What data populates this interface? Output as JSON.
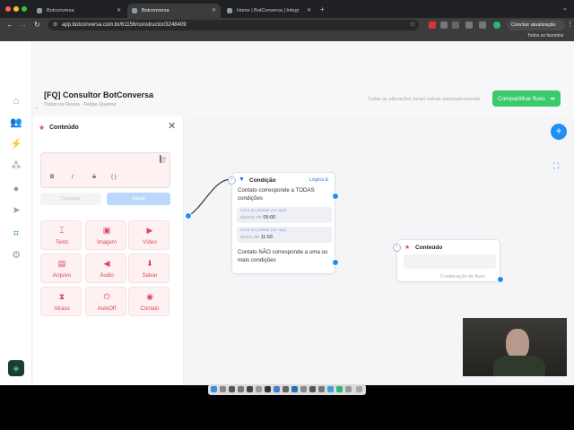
{
  "browser": {
    "tabs": [
      {
        "title": "Botconversa",
        "active": false
      },
      {
        "title": "Botconversa",
        "active": true
      },
      {
        "title": "Home | BotConversa | Integr",
        "active": false
      }
    ],
    "url": "app.botconversa.com.br/61156/constructor/3248409",
    "update_button": "Concluir atualização",
    "bookmarks_label": "Todos os favoritos"
  },
  "sidebar": {
    "items": [
      "home-icon",
      "users-icon",
      "bolt-icon",
      "share-icon",
      "chat-icon",
      "send-icon",
      "flow-icon",
      "gear-icon"
    ],
    "active_index": 6
  },
  "header": {
    "title": "[FQ] Consultor BotConversa",
    "breadcrumb": "Todos os Fluxos · Felipe Queiroz",
    "saved_status": "Todas as alterações foram salvas automaticamente",
    "share_button": "Compartilhar fluxo"
  },
  "panel": {
    "title": "Conteúdo",
    "format_buttons": [
      "B",
      "I",
      "S",
      "{ }"
    ],
    "cancel_label": "Cancelar",
    "save_label": "Salvar",
    "content_types": [
      {
        "label": "Texto",
        "icon": "text-icon",
        "glyph": "⌶"
      },
      {
        "label": "Imagem",
        "icon": "image-icon",
        "glyph": "▣"
      },
      {
        "label": "Vídeo",
        "icon": "video-icon",
        "glyph": "▶"
      },
      {
        "label": "Arquivo",
        "icon": "file-icon",
        "glyph": "▤"
      },
      {
        "label": "Áudio",
        "icon": "audio-icon",
        "glyph": "◀"
      },
      {
        "label": "Salvar",
        "icon": "save-icon",
        "glyph": "⬇"
      },
      {
        "label": "Atraso",
        "icon": "delay-icon",
        "glyph": "⧗"
      },
      {
        "label": "AutoOff",
        "icon": "power-icon",
        "glyph": "⏻"
      },
      {
        "label": "Contato",
        "icon": "contact-icon",
        "glyph": "◉"
      }
    ]
  },
  "canvas": {
    "condition_node": {
      "title": "Condição",
      "logic": "Lógica E",
      "true_text": "Contato corresponde a TODAS condições",
      "rules": [
        {
          "label": "Hora ao passar por aqui",
          "op": "depois de",
          "value": "05:00"
        },
        {
          "label": "Hora ao passar por aqui",
          "op": "antes de",
          "value": "11:59"
        }
      ],
      "false_text": "Contato NÃO corresponde a uma ou mais condições"
    },
    "content_node": {
      "title": "Conteúdo",
      "next_label": "Continuação do fluxo"
    }
  },
  "colors": {
    "brand_green": "#3cc96b",
    "accent_blue": "#1d8ff5",
    "content_red": "#e0445a"
  }
}
